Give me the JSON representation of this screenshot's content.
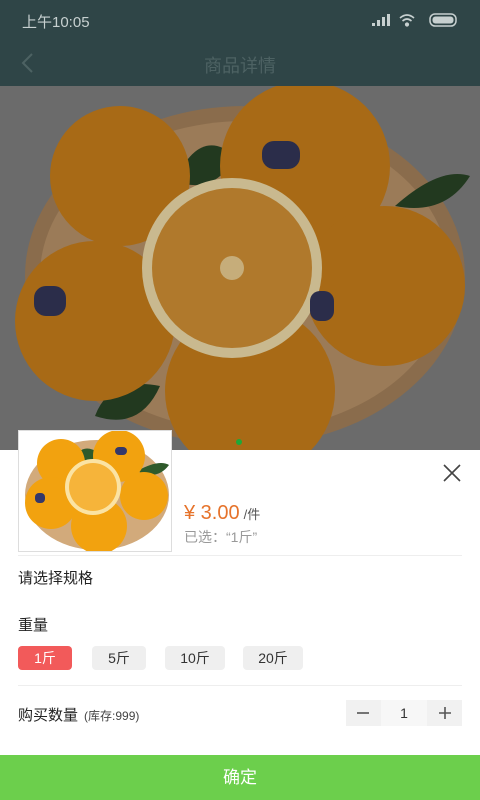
{
  "status_bar": {
    "time": "上午10:05"
  },
  "header": {
    "title": "商品详情"
  },
  "product": {
    "price": "¥ 3.00",
    "unit": "/件",
    "selected": "已选：“1斤”"
  },
  "spec": {
    "prompt": "请选择规格",
    "group_label": "重量",
    "options": [
      "1斤",
      "5斤",
      "10斤",
      "20斤"
    ],
    "selected_option": "1斤"
  },
  "quantity": {
    "label": "购买数量",
    "stock": "(库存:999)",
    "value": "1"
  },
  "actions": {
    "confirm": "确定"
  },
  "colors": {
    "header_bg": "#2f4547",
    "price": "#e6732b",
    "chip_active": "#f25a5a",
    "confirm_bg": "#6ccf4c"
  }
}
